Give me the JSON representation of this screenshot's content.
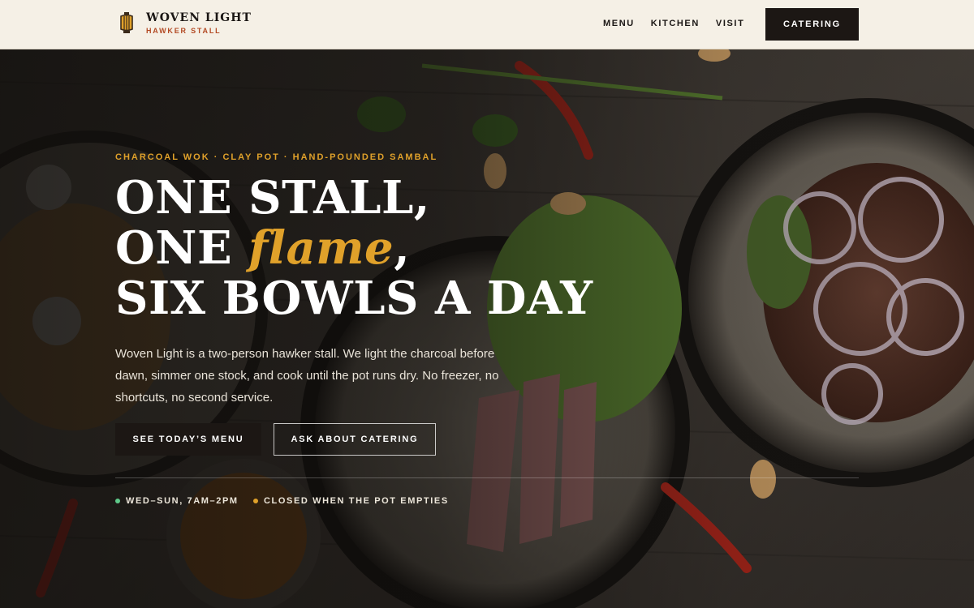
{
  "brand": {
    "name": "WOVEN LIGHT",
    "subtitle": "HAWKER STALL",
    "logo_icon": "lantern-icon"
  },
  "nav": {
    "items": [
      "MENU",
      "KITCHEN",
      "VISIT"
    ],
    "cta": "CATERING"
  },
  "hero": {
    "eyebrow": "CHARCOAL WOK · CLAY POT · HAND-POUNDED SAMBAL",
    "headline": {
      "line1": "ONE STALL,",
      "line2_before": "ONE ",
      "line2_accent": "flame",
      "line2_after": ",",
      "line3": "SIX BOWLS A DAY"
    },
    "lede": "Woven Light is a two-person hawker stall. We light the charcoal before dawn, simmer one stock, and cook until the pot runs dry. No freezer, no shortcuts, no second service.",
    "primary_button": "SEE TODAY’S MENU",
    "secondary_button": "ASK ABOUT CATERING",
    "status": [
      {
        "label": "WED–SUN, 7AM–2PM",
        "color": "#5fc98a"
      },
      {
        "label": "CLOSED WHEN THE POT EMPTIES",
        "color": "#e0a12a"
      }
    ]
  },
  "colors": {
    "accent": "#e0a12a",
    "brand_red": "#b34a24",
    "header_bg": "#f5f0e6",
    "dark": "#1c1714"
  }
}
